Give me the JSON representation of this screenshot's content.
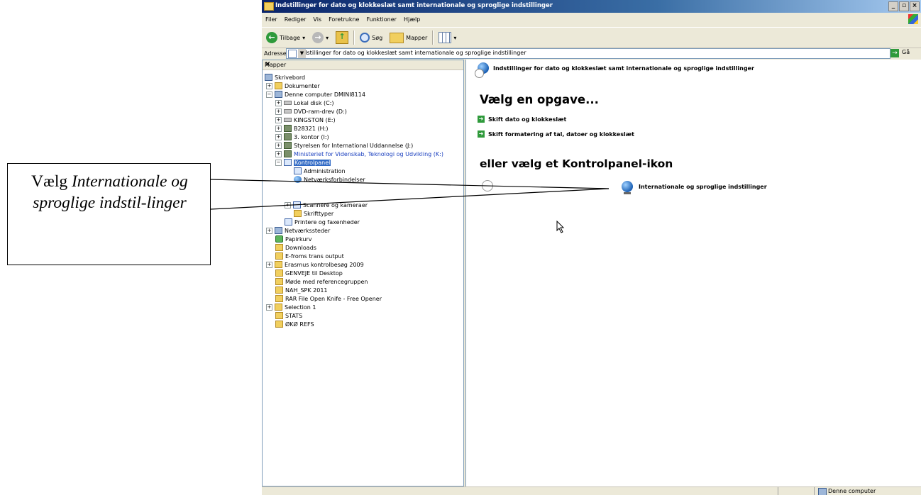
{
  "window": {
    "title": "Indstillinger for dato og klokkeslæt samt internationale og sproglige indstillinger"
  },
  "menu": [
    "Filer",
    "Rediger",
    "Vis",
    "Foretrukne",
    "Funktioner",
    "Hjælp"
  ],
  "toolbar": {
    "back": "Tilbage",
    "search": "Søg",
    "folders": "Mapper"
  },
  "address": {
    "label": "Adresse",
    "value": "Indstillinger for dato og klokkeslæt samt internationale og sproglige indstillinger",
    "go": "Gå"
  },
  "folders_pane": {
    "title": "Mapper",
    "items": [
      "Skrivebord",
      "Dokumenter",
      "Denne computer DMINI8114",
      "Lokal disk (C:)",
      "DVD-ram-drev (D:)",
      "KINGSTON (E:)",
      "B28321 (H:)",
      "3. kontor (I:)",
      "Styrelsen for International Uddannelse (J:)",
      "Ministeriet for Videnskab, Teknologi og Udvikling (K:)",
      "Kontrolpanel",
      "Administration",
      "Netværksforbindelser",
      "Scannere og kameraer",
      "Skrifttyper",
      "Printere og faxenheder",
      "Netværkssteder",
      "Papirkurv",
      "Downloads",
      "E-froms trans output",
      "Erasmus kontrolbesøg 2009",
      "GENVEJE til Desktop",
      "Møde med referencegruppen",
      "NAH_SPK 2011",
      "RAR File Open Knife - Free Opener",
      "Selection 1",
      "STATS",
      "ØKØ REFS"
    ]
  },
  "main": {
    "heading": "Indstillinger for dato og klokkeslæt samt internationale og sproglige indstillinger",
    "pick_task": "Vælg en opgave...",
    "tasks": [
      "Skift dato og klokkeslæt",
      "Skift formatering af tal, datoer og klokkeslæt"
    ],
    "or_pick": "eller vælg et Kontrolpanel-ikon",
    "cp_item": "Internationale og sproglige indstillinger"
  },
  "statusbar": {
    "location": "Denne computer"
  },
  "callout": {
    "lead": "Vælg ",
    "emph": "Internationale og sproglige indstil-linger"
  }
}
